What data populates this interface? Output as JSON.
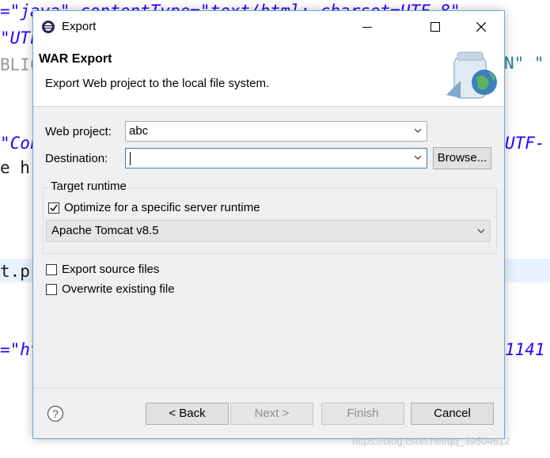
{
  "background_editor": {
    "lines": [
      {
        "text": "=\"java\" contentType=\"text/html; charset=UTF-8\"",
        "style": "purple"
      },
      {
        "text": "\"UTF",
        "style": "purple"
      },
      {
        "text": "BLIC",
        "style": "gray"
      },
      {
        "text": "N\" \"",
        "style": "teal"
      },
      {
        "text": "\"Con",
        "style": "purple"
      },
      {
        "text": "UTF-",
        "style": "purple"
      },
      {
        "text": "e h",
        "style": "dark"
      },
      {
        "text": "t.pr",
        "style": "dark"
      },
      {
        "text": "=\"ht",
        "style": "purple"
      },
      {
        "text": "1141",
        "style": "purple"
      }
    ],
    "watermark": "https://blog.csdn.net/qq_39504612"
  },
  "dialog": {
    "title": "Export",
    "window_buttons": {
      "minimize": "—",
      "maximize": "☐",
      "close": "✕"
    },
    "banner": {
      "title": "WAR Export",
      "description": "Export Web project to the local file system."
    },
    "web_project": {
      "label": "Web project:",
      "value": "abc"
    },
    "destination": {
      "label": "Destination:",
      "value": "",
      "browse_label": "Browse..."
    },
    "target_runtime": {
      "group_label": "Target runtime",
      "optimize_label": "Optimize for a specific server runtime",
      "optimize_checked": true,
      "server_value": "Apache Tomcat v8.5"
    },
    "export_source": {
      "label": "Export source files",
      "checked": false
    },
    "overwrite": {
      "label": "Overwrite existing file",
      "checked": false
    },
    "buttons": {
      "help": "?",
      "back": "< Back",
      "next": "Next >",
      "finish": "Finish",
      "cancel": "Cancel"
    }
  }
}
